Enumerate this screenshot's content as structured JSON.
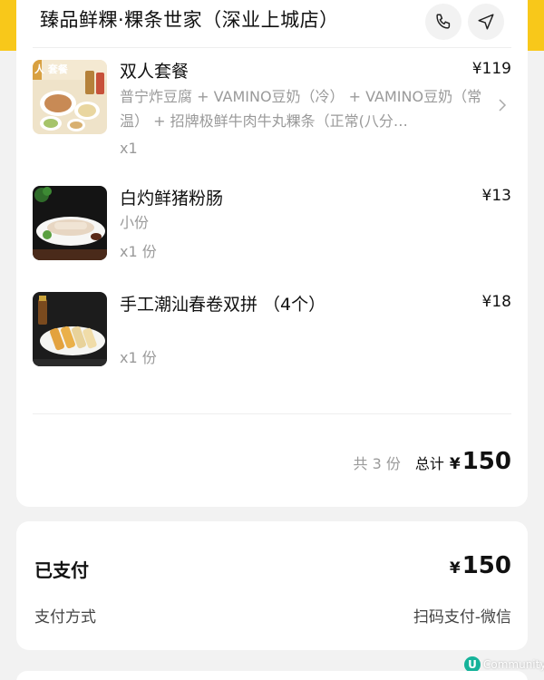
{
  "header": {
    "store_name": "臻品鲜粿·粿条世家（深业上城店）",
    "brand_color": "#f8c81a"
  },
  "items": [
    {
      "name": "双人套餐",
      "price": "¥119",
      "desc": "普宁炸豆腐 + VAMINO豆奶（冷） + VAMINO豆奶（常温） + 招牌极鲜牛肉牛丸粿条（正常(八分…",
      "qty": "x1",
      "thumb_badge": "人 套餐"
    },
    {
      "name": "白灼鲜猪粉肠",
      "price": "¥13",
      "desc": "小份",
      "qty": "x1 份"
    },
    {
      "name": "手工潮汕春卷双拼 （4个）",
      "price": "¥18",
      "desc": "",
      "qty": "x1 份"
    }
  ],
  "summary": {
    "count": "共 3 份",
    "total_label": "总计",
    "currency": "¥",
    "amount": "150"
  },
  "payment": {
    "status": "已支付",
    "currency": "¥",
    "amount": "150",
    "method_label": "支付方式",
    "method_value": "扫码支付-微信"
  },
  "watermark": {
    "logo_letter": "U",
    "text": "Community"
  }
}
